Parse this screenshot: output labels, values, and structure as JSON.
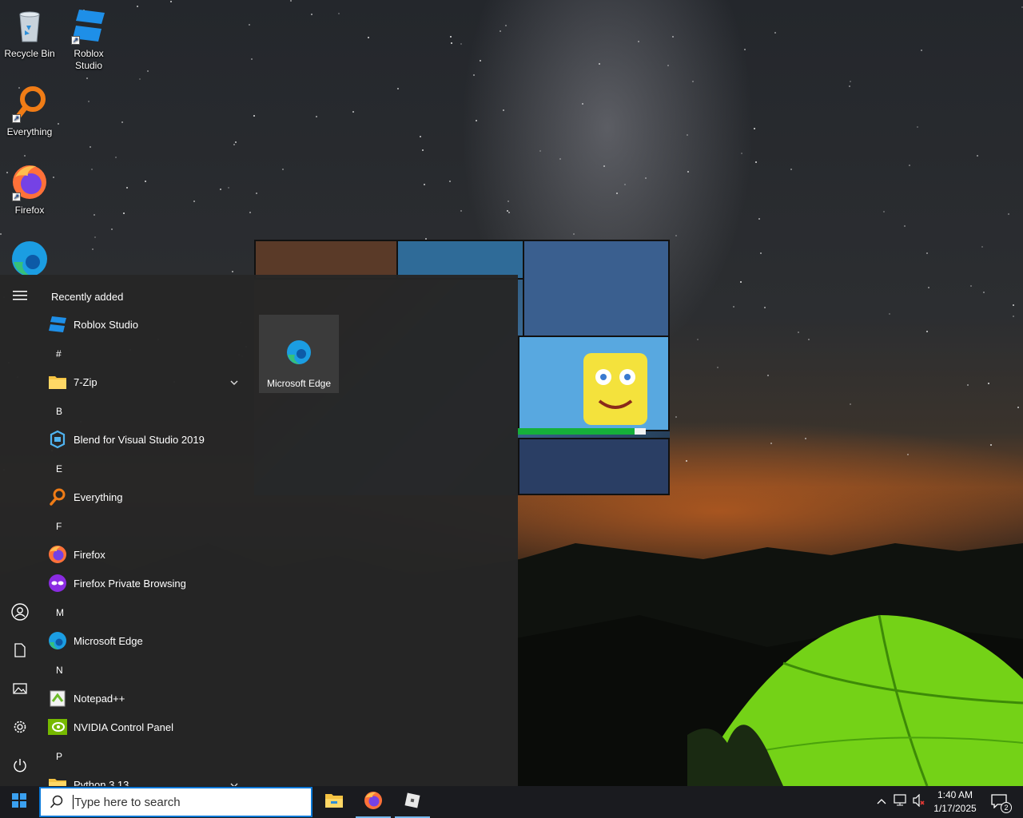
{
  "desktop": {
    "icons": [
      {
        "label": "Recycle Bin",
        "icon": "recycle-bin-icon"
      },
      {
        "label": "Roblox Studio",
        "icon": "roblox-studio-icon"
      },
      {
        "label": "Everything",
        "icon": "everything-search-icon"
      },
      {
        "label": "Firefox",
        "icon": "firefox-icon"
      },
      {
        "label": "",
        "icon": "microsoft-edge-icon"
      }
    ]
  },
  "preview": {
    "progress": 0.91
  },
  "start_menu": {
    "rail": {
      "icons": [
        "hamburger-menu-icon",
        "user-account-icon",
        "documents-icon",
        "pictures-icon",
        "settings-gear-icon",
        "power-icon"
      ]
    },
    "recently_added_label": "Recently added",
    "items": [
      {
        "type": "app",
        "label": "Roblox Studio",
        "icon": "roblox-studio-icon"
      },
      {
        "type": "letter",
        "label": "#"
      },
      {
        "type": "folder",
        "label": "7-Zip",
        "icon": "folder-icon"
      },
      {
        "type": "letter",
        "label": "B"
      },
      {
        "type": "app",
        "label": "Blend for Visual Studio 2019",
        "icon": "blend-icon"
      },
      {
        "type": "letter",
        "label": "E"
      },
      {
        "type": "app",
        "label": "Everything",
        "icon": "everything-search-icon"
      },
      {
        "type": "letter",
        "label": "F"
      },
      {
        "type": "app",
        "label": "Firefox",
        "icon": "firefox-icon"
      },
      {
        "type": "app",
        "label": "Firefox Private Browsing",
        "icon": "firefox-private-icon"
      },
      {
        "type": "letter",
        "label": "M"
      },
      {
        "type": "app",
        "label": "Microsoft Edge",
        "icon": "microsoft-edge-icon"
      },
      {
        "type": "letter",
        "label": "N"
      },
      {
        "type": "app",
        "label": "Notepad++",
        "icon": "notepad-plus-plus-icon"
      },
      {
        "type": "app",
        "label": "NVIDIA Control Panel",
        "icon": "nvidia-icon"
      },
      {
        "type": "letter",
        "label": "P"
      },
      {
        "type": "folder",
        "label": "Python 3.13",
        "icon": "folder-icon"
      }
    ],
    "tile": {
      "label": "Microsoft Edge",
      "icon": "microsoft-edge-icon"
    }
  },
  "taskbar": {
    "search_placeholder": "Type here to search",
    "apps": [
      "file-explorer-icon",
      "firefox-icon",
      "roblox-studio-icon"
    ],
    "tray_icons": [
      "chevron-up-icon",
      "network-icon",
      "volume-muted-icon"
    ],
    "time": "1:40 AM",
    "date": "1/17/2025",
    "notification_count": "2"
  },
  "colors": {
    "accent": "#0a78d7",
    "start_bg": "#262626",
    "taskbar_bg": "#1a1b1f",
    "progress_green": "#16b03a"
  }
}
